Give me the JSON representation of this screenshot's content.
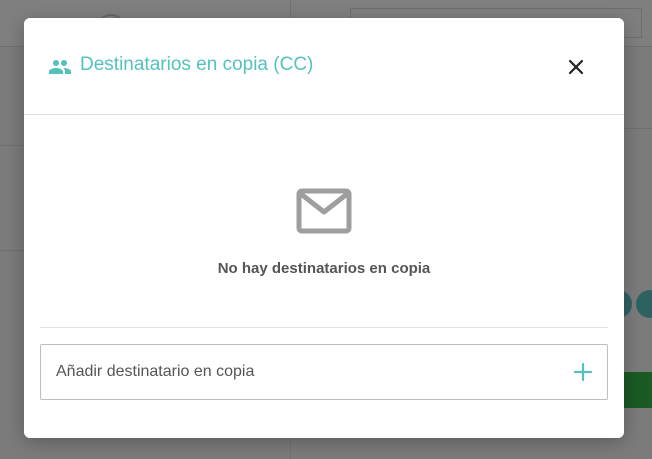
{
  "modal": {
    "title": "Destinatarios en copia (CC)",
    "title_icon": "people-icon",
    "close_icon": "close-icon",
    "empty_state": {
      "icon": "mail-icon",
      "message": "No hay destinatarios en copia"
    },
    "add_field": {
      "placeholder": "Añadir destinatario en copia",
      "value": "",
      "add_icon": "plus-icon"
    }
  },
  "colors": {
    "accent": "#54c1bd",
    "overlay": "rgba(0,0,0,0.5)",
    "text_muted": "#555555",
    "icon_gray": "#9e9e9e"
  }
}
